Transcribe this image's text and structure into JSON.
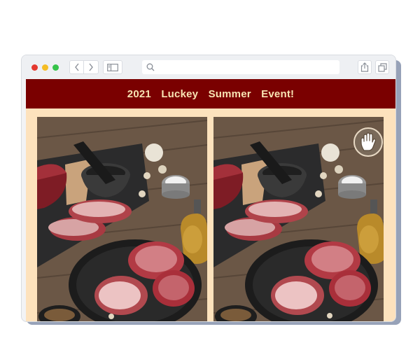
{
  "app": {
    "title": "2021 Luckey Summer Event!"
  },
  "browser": {
    "back_icon": "chevron-left-icon",
    "forward_icon": "chevron-right-icon",
    "sidebar_icon": "sidebar-icon",
    "search_icon": "search-icon",
    "share_icon": "share-icon",
    "tabs_icon": "tabs-icon",
    "address_value": ""
  },
  "game": {
    "hint_icon": "hand-icon",
    "left_image": "steak-board-original",
    "right_image": "steak-board-modified"
  },
  "colors": {
    "header_bg": "#7a0000",
    "title_text": "#f7e3b3",
    "content_bg": "#fde2bd"
  }
}
